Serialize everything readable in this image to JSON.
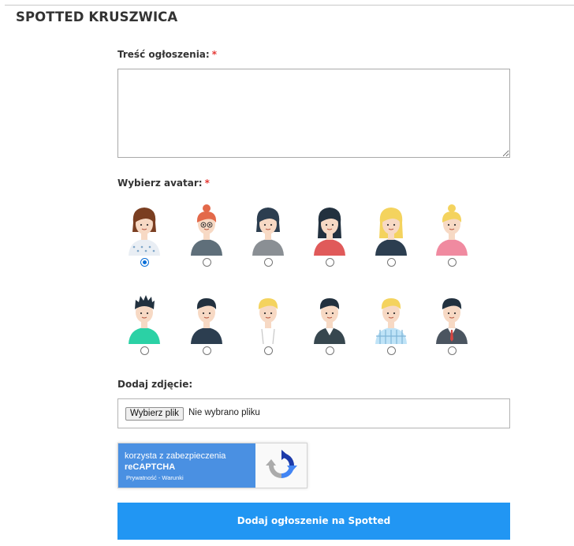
{
  "page": {
    "title": "SPOTTED KRUSZWICA"
  },
  "form": {
    "content_label": "Treść ogłoszenia:",
    "required_mark": "*",
    "content_value": "",
    "avatar_label": "Wybierz avatar:",
    "avatars": [
      {
        "icon": "woman-brown-bob-avatar-icon",
        "selected": true
      },
      {
        "icon": "woman-red-bun-glasses-avatar-icon",
        "selected": false
      },
      {
        "icon": "woman-dark-bob-avatar-icon",
        "selected": false
      },
      {
        "icon": "woman-dark-long-hair-avatar-icon",
        "selected": false
      },
      {
        "icon": "woman-blonde-avatar-icon",
        "selected": false
      },
      {
        "icon": "woman-blonde-bun-avatar-icon",
        "selected": false
      },
      {
        "icon": "man-spiky-hair-green-shirt-avatar-icon",
        "selected": false
      },
      {
        "icon": "man-dark-hair-avatar-icon",
        "selected": false
      },
      {
        "icon": "man-blonde-tank-top-avatar-icon",
        "selected": false
      },
      {
        "icon": "man-dark-hair-jacket-avatar-icon",
        "selected": false
      },
      {
        "icon": "man-blonde-checked-shirt-avatar-icon",
        "selected": false
      },
      {
        "icon": "man-suit-tie-avatar-icon",
        "selected": false
      }
    ],
    "photo_label": "Dodaj zdjęcie:",
    "file_button": "Wybierz plik",
    "file_status": "Nie wybrano pliku",
    "captcha": {
      "line1": "korzysta z zabezpieczenia",
      "line2": "reCAPTCHA",
      "links": "Prywatność - Warunki",
      "icon": "recaptcha-logo-icon"
    },
    "submit_label": "Dodaj ogłoszenie na Spotted"
  },
  "colors": {
    "accent": "#2196f3",
    "required": "#e53935",
    "captcha_blue": "#4a90e2"
  }
}
